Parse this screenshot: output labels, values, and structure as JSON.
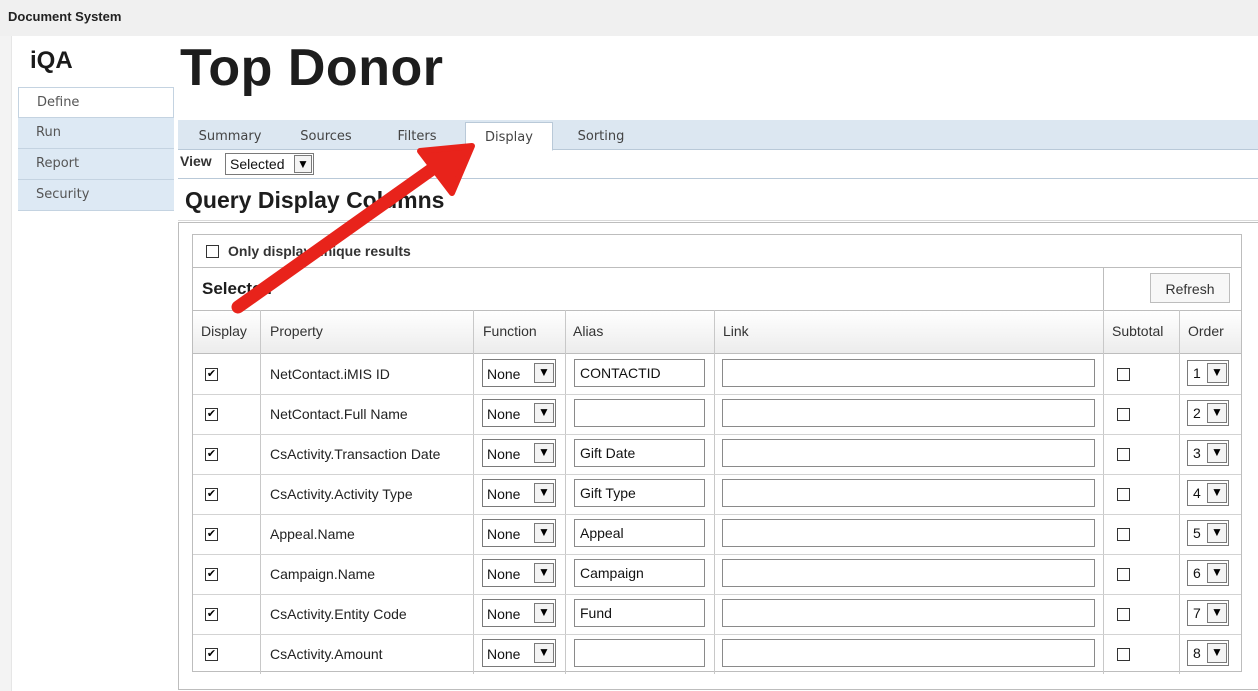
{
  "window": {
    "title": "Document System"
  },
  "app": {
    "name": "iQA"
  },
  "sidebar": {
    "items": [
      {
        "label": "Define",
        "active": true
      },
      {
        "label": "Run",
        "active": false
      },
      {
        "label": "Report",
        "active": false
      },
      {
        "label": "Security",
        "active": false
      }
    ]
  },
  "page": {
    "title": "Top Donor"
  },
  "tabs": [
    {
      "label": "Summary",
      "active": false
    },
    {
      "label": "Sources",
      "active": false
    },
    {
      "label": "Filters",
      "active": false
    },
    {
      "label": "Display",
      "active": true
    },
    {
      "label": "Sorting",
      "active": false
    }
  ],
  "view": {
    "label": "View",
    "selected": "Selected"
  },
  "section": {
    "title": "Query Display Columns"
  },
  "unique_results": {
    "label": "Only display unique results",
    "checked": false
  },
  "selected_panel": {
    "title": "Selected",
    "refresh_label": "Refresh"
  },
  "columns": {
    "display": "Display",
    "property": "Property",
    "function": "Function",
    "alias": "Alias",
    "link": "Link",
    "subtotal": "Subtotal",
    "order": "Order"
  },
  "rows": [
    {
      "display": true,
      "property": "NetContact.iMIS ID",
      "function": "None",
      "alias": "CONTACTID",
      "link": "",
      "subtotal": false,
      "order": "1"
    },
    {
      "display": true,
      "property": "NetContact.Full Name",
      "function": "None",
      "alias": "",
      "link": "",
      "subtotal": false,
      "order": "2"
    },
    {
      "display": true,
      "property": "CsActivity.Transaction Date",
      "function": "None",
      "alias": "Gift Date",
      "link": "",
      "subtotal": false,
      "order": "3"
    },
    {
      "display": true,
      "property": "CsActivity.Activity Type",
      "function": "None",
      "alias": "Gift Type",
      "link": "",
      "subtotal": false,
      "order": "4"
    },
    {
      "display": true,
      "property": "Appeal.Name",
      "function": "None",
      "alias": "Appeal",
      "link": "",
      "subtotal": false,
      "order": "5"
    },
    {
      "display": true,
      "property": "Campaign.Name",
      "function": "None",
      "alias": "Campaign",
      "link": "",
      "subtotal": false,
      "order": "6"
    },
    {
      "display": true,
      "property": "CsActivity.Entity Code",
      "function": "None",
      "alias": "Fund",
      "link": "",
      "subtotal": false,
      "order": "7"
    },
    {
      "display": true,
      "property": "CsActivity.Amount",
      "function": "None",
      "alias": "",
      "link": "",
      "subtotal": false,
      "order": "8"
    }
  ],
  "icons": {
    "dropdown": "chevron-down-icon",
    "check": "checkmark-icon",
    "annotation": "red-arrow-icon"
  },
  "colors": {
    "tab_strip": "#dce7f1",
    "sidebar": "#dde9f4",
    "annotation_arrow": "#e8231b"
  }
}
